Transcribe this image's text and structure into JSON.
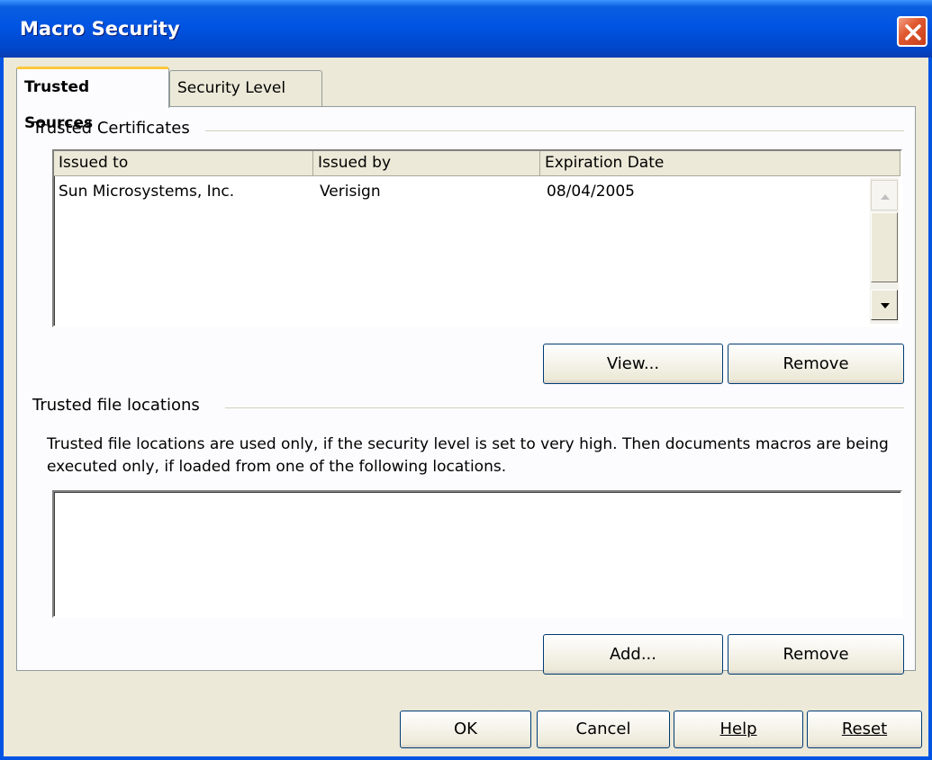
{
  "window": {
    "title": "Macro Security"
  },
  "tabs": [
    {
      "label": "Trusted Sources",
      "active": true
    },
    {
      "label": "Security Level",
      "active": false
    }
  ],
  "trusted_certificates": {
    "group_label": "Trusted Certificates",
    "columns": [
      "Issued to",
      "Issued by",
      "Expiration Date"
    ],
    "rows": [
      {
        "issued_to": "Sun Microsystems, Inc.",
        "issued_by": "Verisign",
        "expiration": "08/04/2005"
      }
    ],
    "view_label": "View...",
    "remove_label": "Remove"
  },
  "trusted_locations": {
    "group_label": "Trusted file locations",
    "description": "Trusted file locations are used only, if the security level is set to very high. Then documents macros are being executed only, if loaded from one of the following locations.",
    "add_label": "Add...",
    "remove_label": "Remove"
  },
  "footer": {
    "ok_label": "OK",
    "cancel_label": "Cancel",
    "help_label": "Help",
    "reset_label": "Reset"
  },
  "colors": {
    "title_bar": "#0054e3",
    "dialog_bg": "#ece9d8",
    "panel_bg": "#fcfcfe"
  }
}
